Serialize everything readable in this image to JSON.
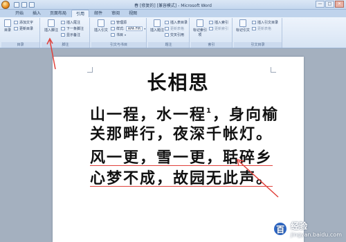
{
  "window": {
    "title": "春 [修复的] [兼容模式] - Microsoft Word",
    "min_label": "—",
    "max_label": "□",
    "close_label": "✕"
  },
  "tabs": [
    "开始",
    "插入",
    "页面布局",
    "引用",
    "邮件",
    "审阅",
    "视图"
  ],
  "ribbon": {
    "toc": {
      "big_label": "目录",
      "add_text": "添加文字",
      "update_toc": "更新目录",
      "group_label": "目录"
    },
    "footnotes": {
      "insert_footnote": "插入脚注",
      "insert_endnote": "插入尾注",
      "next_footnote": "下一条脚注",
      "show_notes": "显示备注",
      "group_label": "脚注"
    },
    "citations": {
      "insert_citation": "插入引文",
      "manage_sources": "管理源",
      "style_label": "样式:",
      "style_value": "APA Fift",
      "bibliography": "书目",
      "group_label": "引文与书目"
    },
    "captions": {
      "insert_caption": "插入题注",
      "insert_table_of_figures": "插入表目录",
      "update_table": "更新表格",
      "cross_reference": "交叉引用",
      "group_label": "题注"
    },
    "index": {
      "mark_entry": "标记索引项",
      "insert_index": "插入索引",
      "update_index": "更新索引",
      "group_label": "索引"
    },
    "toa": {
      "mark_citation": "标记引文",
      "insert_toa": "插入引文目录",
      "update_table": "更新表格",
      "group_label": "引文目录"
    }
  },
  "document": {
    "title": "长相思",
    "line1_a": "山一程，水一程",
    "footnote_mark": "1",
    "line1_b": "，身向榆",
    "line2": "关那畔行，夜深千帐灯。",
    "line3": "风一更，雪一更，聒碎乡",
    "line4": "心梦不成，故园无此声。"
  },
  "watermark": {
    "brand": "经验",
    "site": "jingyan.baidu.com",
    "logo_glyph": "百"
  },
  "colors": {
    "annotation_arrow": "#e0403a",
    "ribbon_bg": "#dde8f6"
  }
}
